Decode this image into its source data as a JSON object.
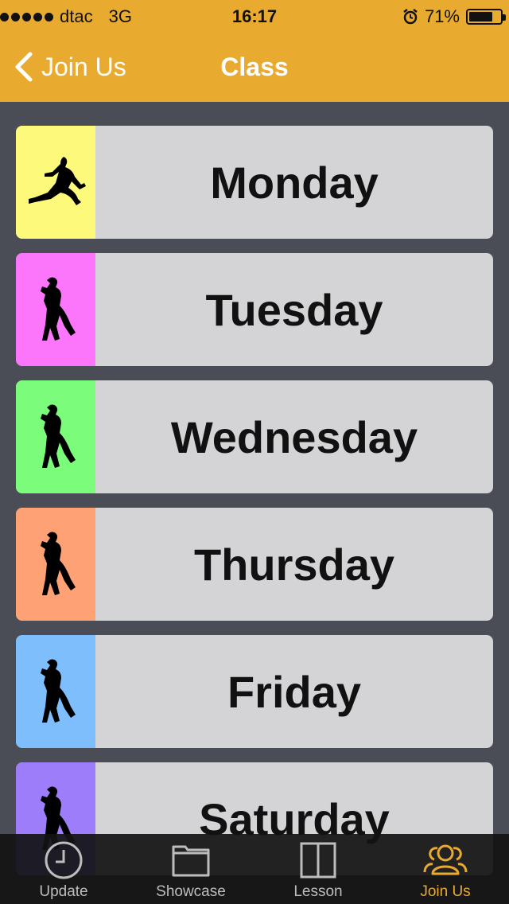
{
  "status_bar": {
    "carrier": "dtac",
    "network": "3G",
    "time": "16:17",
    "battery": "71%",
    "battery_level": 0.71
  },
  "nav": {
    "back_label": "Join Us",
    "title": "Class"
  },
  "days": [
    {
      "label": "Monday",
      "color": "#fdf97a"
    },
    {
      "label": "Tuesday",
      "color": "#fb76fb"
    },
    {
      "label": "Wednesday",
      "color": "#7bfc7a"
    },
    {
      "label": "Thursday",
      "color": "#fea175"
    },
    {
      "label": "Friday",
      "color": "#7fbefd"
    },
    {
      "label": "Saturday",
      "color": "#9d7dfa"
    }
  ],
  "tabs": [
    {
      "label": "Update",
      "icon": "clock-icon"
    },
    {
      "label": "Showcase",
      "icon": "folder-icon"
    },
    {
      "label": "Lesson",
      "icon": "book-icon"
    },
    {
      "label": "Join Us",
      "icon": "people-icon",
      "active": true
    }
  ],
  "colors": {
    "accent": "#e8ab30",
    "background": "#4a4d55"
  }
}
